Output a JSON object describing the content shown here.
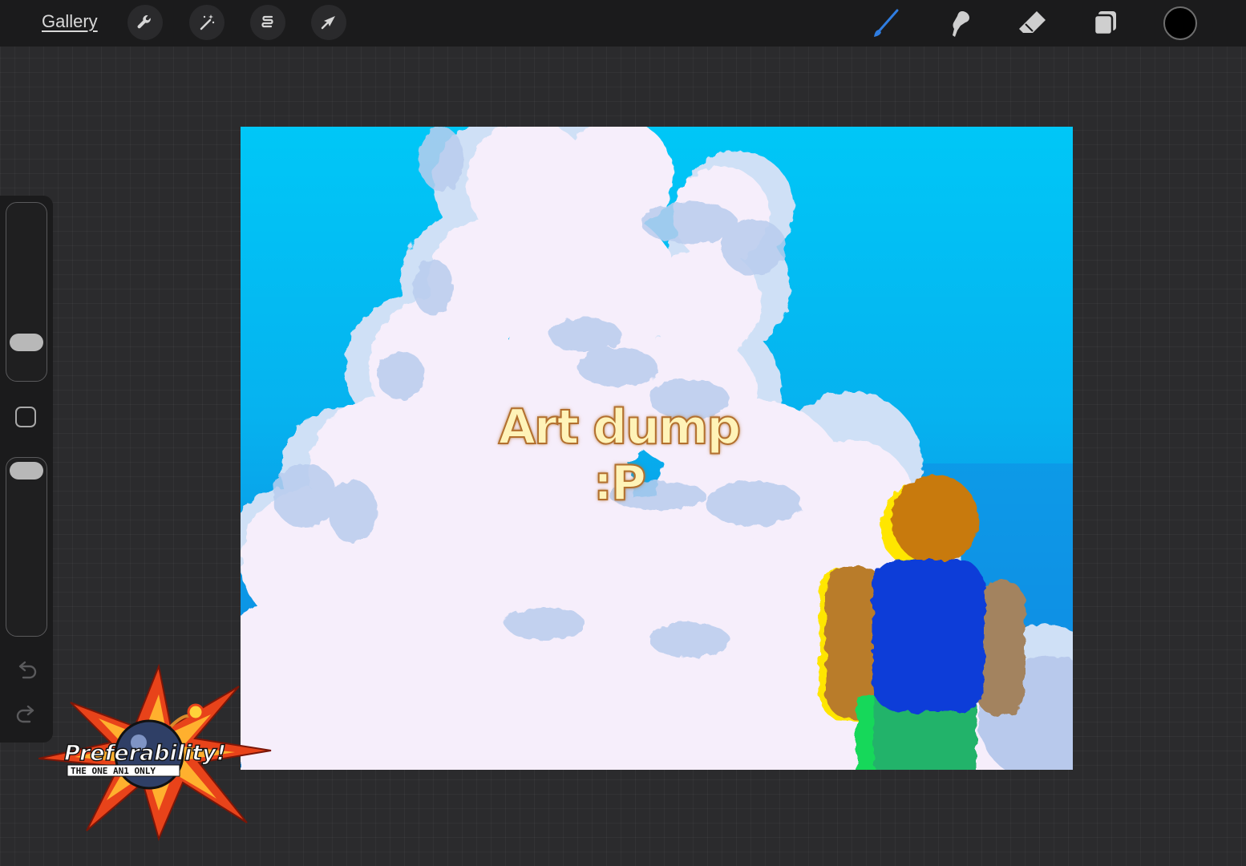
{
  "toolbar": {
    "gallery_label": "Gallery",
    "left_tools": [
      "wrench-icon",
      "magic-wand-icon",
      "selection-icon",
      "transform-arrow-icon"
    ],
    "right_tools": [
      "brush-icon",
      "smudge-icon",
      "eraser-icon",
      "layers-icon"
    ],
    "active_tool": "brush",
    "active_color": "#000000",
    "accent_color": "#2f7de1"
  },
  "sidebar": {
    "brush_size_level": 0.25,
    "opacity_level": 0.92
  },
  "canvas": {
    "title_text": "Art dump :P",
    "sky_color": "#00c7f7",
    "cloud_color": "#f6eefb",
    "figure_colors": {
      "head": "#c87a10",
      "torso": "#0a3ed8",
      "arms": "#b97c29",
      "legs": "#22b36a"
    }
  },
  "watermark": {
    "logo_text": "Preferability!",
    "tagline": "THE ONE AN1 ONLY"
  }
}
